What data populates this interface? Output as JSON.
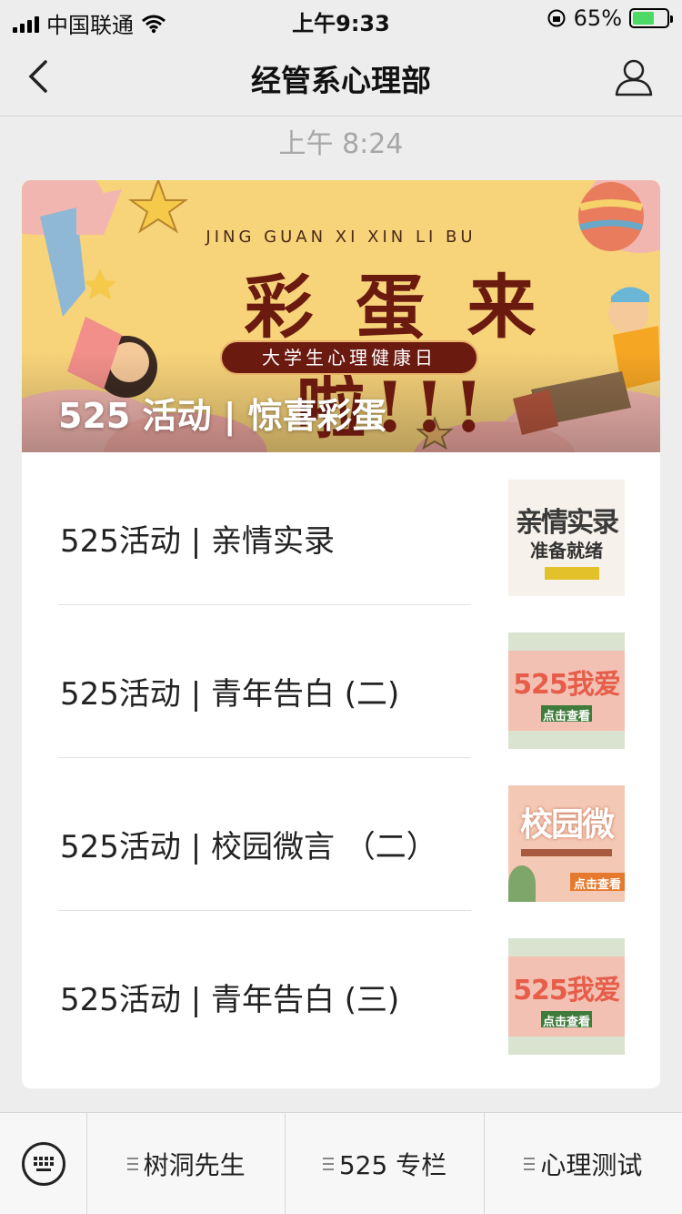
{
  "status_bar": {
    "carrier": "中国联通",
    "time": "上午9:33",
    "battery": "65%",
    "battery_level": 0.65
  },
  "nav": {
    "title": "经管系心理部"
  },
  "message_time": "上午 8:24",
  "banner": {
    "subtitle": "JING GUAN XI XIN LI BU",
    "big_text": "彩 蛋 来 啦!!!",
    "pill_text": "大学生心理健康日",
    "headline": "525 活动 | 惊喜彩蛋"
  },
  "articles": [
    {
      "title": "525活动 | 亲情实录",
      "thumb_text": "亲情实录",
      "thumb_sub": "准备就绪"
    },
    {
      "title": "525活动 | 青年告白 (二)",
      "thumb_text": "525我爱",
      "thumb_sub": "点击查看"
    },
    {
      "title": "525活动 | 校园微言 （二）",
      "thumb_text": "校园微",
      "thumb_sub": "点击查看"
    },
    {
      "title": "525活动 | 青年告白 (三)",
      "thumb_text": "525我爱",
      "thumb_sub": "点击查看"
    }
  ],
  "bottom_menu": [
    "树洞先生",
    "525 专栏",
    "心理测试"
  ],
  "colors": {
    "banner_bg": "#f7d37a",
    "banner_text": "#6b1a10",
    "battery_fill": "#4cd964"
  }
}
